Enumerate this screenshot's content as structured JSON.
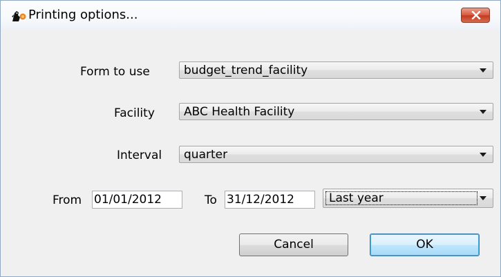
{
  "window": {
    "title": "Printing options...",
    "icon": "app-logo-icon",
    "close": "close-icon"
  },
  "form": {
    "form_label": "Form to use",
    "form_value": "budget_trend_facility",
    "facility_label": "Facility",
    "facility_value": "ABC Health Facility",
    "interval_label": "Interval",
    "interval_value": "quarter",
    "from_label": "From",
    "from_value": "01/01/2012",
    "to_label": "To",
    "to_value": "31/12/2012",
    "period_value": "Last year"
  },
  "buttons": {
    "cancel": "Cancel",
    "ok": "OK"
  },
  "colors": {
    "close_button": "#d8593f",
    "default_button_border": "#3c7fb1"
  }
}
